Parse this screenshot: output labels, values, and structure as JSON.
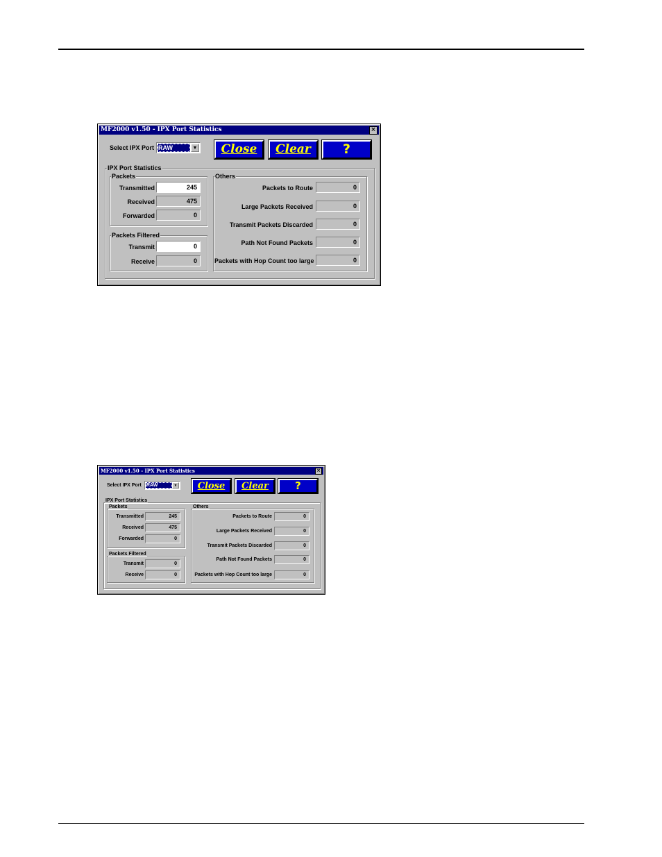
{
  "dialog": {
    "title": "MF2000 v1.50 - IPX Port Statistics",
    "close_box": "×",
    "select_port_label": "Select IPX Port",
    "selected_port": "RAW",
    "buttons": {
      "close": "Close",
      "clear": "Clear",
      "help": "?"
    },
    "stats_group": "IPX Port Statistics",
    "packets_group": "Packets",
    "packets": [
      {
        "label": "Transmitted",
        "value": "245"
      },
      {
        "label": "Received",
        "value": "475"
      },
      {
        "label": "Forwarded",
        "value": "0"
      }
    ],
    "filtered_group": "Packets Filtered",
    "filtered": [
      {
        "label": "Transmit",
        "value": "0"
      },
      {
        "label": "Receive",
        "value": "0"
      }
    ],
    "others_group": "Others",
    "others": [
      {
        "label": "Packets to Route",
        "value": "0"
      },
      {
        "label": "Large Packets Received",
        "value": "0"
      },
      {
        "label": "Transmit Packets Discarded",
        "value": "0"
      },
      {
        "label": "Path Not Found Packets",
        "value": "0"
      },
      {
        "label": "Packets with Hop Count too large",
        "value": "0"
      }
    ]
  },
  "colors": {
    "title_bar": "#000080",
    "button_face": "#0000c8",
    "button_text": "#ffff00",
    "dialog_face": "#c0c0c0"
  }
}
